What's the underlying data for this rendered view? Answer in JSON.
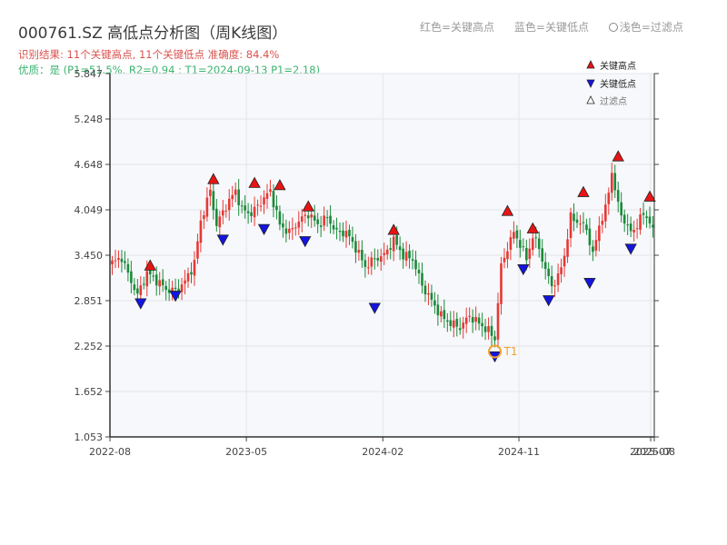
{
  "header": {
    "title": "000761.SZ 高低点分析图（周K线图）",
    "result_line": "识别结果: 11个关键高点, 11个关键低点   准确度: 84.4%",
    "quality_line": "优质：是  (P1=51.5%, R2=0.94 ; T1=2024-09-13 P1=2.18)"
  },
  "top_legend": {
    "red": "红色=关键高点",
    "blue": "蓝色=关键低点",
    "light": "浅色=过滤点"
  },
  "chart_data": {
    "type": "candlestick",
    "title": "000761.SZ 高低点分析图（周K线图）",
    "y_ticks": [
      "1.053",
      "1.652",
      "2.252",
      "2.851",
      "3.450",
      "4.049",
      "4.648",
      "5.248",
      "5.847"
    ],
    "ylim": [
      1.053,
      5.847
    ],
    "x_ticks": [
      "2022-08",
      "2023-05",
      "2024-02",
      "2024-11",
      "2025-07",
      "2025-08"
    ],
    "x_tick_fracs": [
      0.0,
      0.2506,
      0.5013,
      0.7513,
      0.9933,
      1.0
    ],
    "legend": [
      "关键高点",
      "关键低点",
      "过滤点"
    ],
    "legend_position": "top-right",
    "colors": {
      "up": "#e53935",
      "down": "#1b8a3a",
      "high": "#e81414",
      "low": "#1414e0",
      "t1": "#f0a030"
    },
    "candles_anchor_closes": [
      [
        0,
        3.35
      ],
      [
        3,
        3.42
      ],
      [
        5,
        3.2
      ],
      [
        8,
        2.92
      ],
      [
        11,
        3.22
      ],
      [
        14,
        3.12
      ],
      [
        17,
        3.0
      ],
      [
        20,
        2.98
      ],
      [
        23,
        3.1
      ],
      [
        26,
        3.35
      ],
      [
        28,
        3.9
      ],
      [
        31,
        4.3
      ],
      [
        33,
        3.85
      ],
      [
        36,
        4.1
      ],
      [
        39,
        4.3
      ],
      [
        41,
        4.05
      ],
      [
        44,
        4.0
      ],
      [
        47,
        4.15
      ],
      [
        50,
        4.3
      ],
      [
        53,
        3.85
      ],
      [
        56,
        3.75
      ],
      [
        59,
        3.9
      ],
      [
        62,
        4.0
      ],
      [
        65,
        3.85
      ],
      [
        68,
        3.95
      ],
      [
        71,
        3.75
      ],
      [
        74,
        3.75
      ],
      [
        77,
        3.55
      ],
      [
        80,
        3.3
      ],
      [
        83,
        3.4
      ],
      [
        86,
        3.45
      ],
      [
        89,
        3.65
      ],
      [
        92,
        3.45
      ],
      [
        95,
        3.4
      ],
      [
        98,
        3.05
      ],
      [
        101,
        2.85
      ],
      [
        104,
        2.65
      ],
      [
        107,
        2.55
      ],
      [
        110,
        2.5
      ],
      [
        113,
        2.65
      ],
      [
        116,
        2.55
      ],
      [
        119,
        2.45
      ],
      [
        121,
        2.35
      ],
      [
        123,
        3.3
      ],
      [
        125,
        3.55
      ],
      [
        127,
        3.75
      ],
      [
        129,
        3.6
      ],
      [
        131,
        3.4
      ],
      [
        133,
        3.7
      ],
      [
        135,
        3.55
      ],
      [
        137,
        3.25
      ],
      [
        139,
        3.05
      ],
      [
        141,
        3.15
      ],
      [
        143,
        3.45
      ],
      [
        145,
        3.95
      ],
      [
        147,
        3.9
      ],
      [
        150,
        3.8
      ],
      [
        152,
        3.45
      ],
      [
        154,
        3.85
      ],
      [
        156,
        4.05
      ],
      [
        158,
        4.55
      ],
      [
        160,
        4.1
      ],
      [
        162,
        3.9
      ],
      [
        164,
        3.75
      ],
      [
        166,
        3.85
      ],
      [
        168,
        4.0
      ],
      [
        170,
        3.9
      ],
      [
        171,
        3.75
      ]
    ],
    "key_highs": [
      {
        "i": 12,
        "v": 3.23
      },
      {
        "i": 32,
        "v": 4.37
      },
      {
        "i": 45,
        "v": 4.32
      },
      {
        "i": 53,
        "v": 4.29
      },
      {
        "i": 62,
        "v": 4.01
      },
      {
        "i": 89,
        "v": 3.7
      },
      {
        "i": 125,
        "v": 3.95
      },
      {
        "i": 133,
        "v": 3.72
      },
      {
        "i": 149,
        "v": 4.2
      },
      {
        "i": 160,
        "v": 4.67
      },
      {
        "i": 170,
        "v": 4.14
      }
    ],
    "key_lows": [
      {
        "i": 9,
        "v": 2.9
      },
      {
        "i": 20,
        "v": 3.0
      },
      {
        "i": 35,
        "v": 3.74
      },
      {
        "i": 48,
        "v": 3.88
      },
      {
        "i": 61,
        "v": 3.72
      },
      {
        "i": 83,
        "v": 2.84
      },
      {
        "i": 121,
        "v": 2.2
      },
      {
        "i": 130,
        "v": 3.35
      },
      {
        "i": 138,
        "v": 2.94
      },
      {
        "i": 151,
        "v": 3.17
      },
      {
        "i": 164,
        "v": 3.62
      }
    ],
    "t1": {
      "label": "T1",
      "date": "2024-09-13",
      "i": 121,
      "v": 2.18
    }
  }
}
